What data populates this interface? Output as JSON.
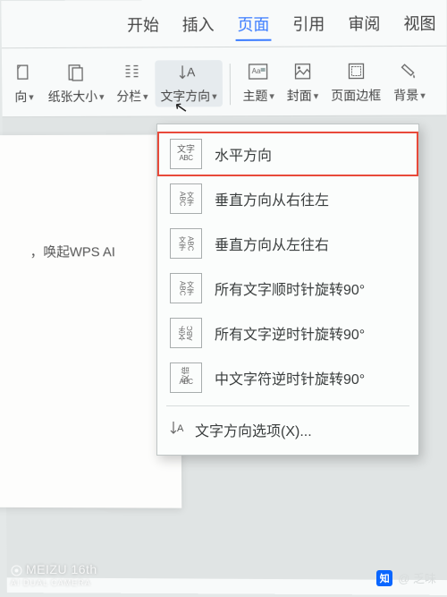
{
  "tabs": {
    "start": "开始",
    "insert": "插入",
    "page": "页面",
    "reference": "引用",
    "review": "审阅",
    "view": "视图"
  },
  "toolbar": {
    "orientation": "向",
    "paperSize": "纸张大小",
    "columns": "分栏",
    "textDirection": "文字方向",
    "theme": "主题",
    "cover": "封面",
    "pageBorder": "页面边框",
    "background": "背景"
  },
  "doc": {
    "placeholder": "，唤起WPS AI"
  },
  "dropdown": {
    "items": [
      {
        "label": "水平方向",
        "icon1": "文字",
        "icon2": "ABC"
      },
      {
        "label": "垂直方向从右往左",
        "icon1": "文字",
        "icon2": "ABC"
      },
      {
        "label": "垂直方向从左往右",
        "icon1": "文字",
        "icon2": "ABC"
      },
      {
        "label": "所有文字顺时针旋转90°",
        "icon1": "文字",
        "icon2": "ABC"
      },
      {
        "label": "所有文字逆时针旋转90°",
        "icon1": "文字",
        "icon2": "ABC"
      },
      {
        "label": "中文字符逆时针旋转90°",
        "icon1": "仪倍",
        "icon2": "ABC"
      }
    ],
    "options": "文字方向选项(X)..."
  },
  "watermark": {
    "brand": "MEIZU 16th",
    "sub": "AI DUAL CAMERA",
    "zh": "知",
    "author": "@ 乏味"
  }
}
